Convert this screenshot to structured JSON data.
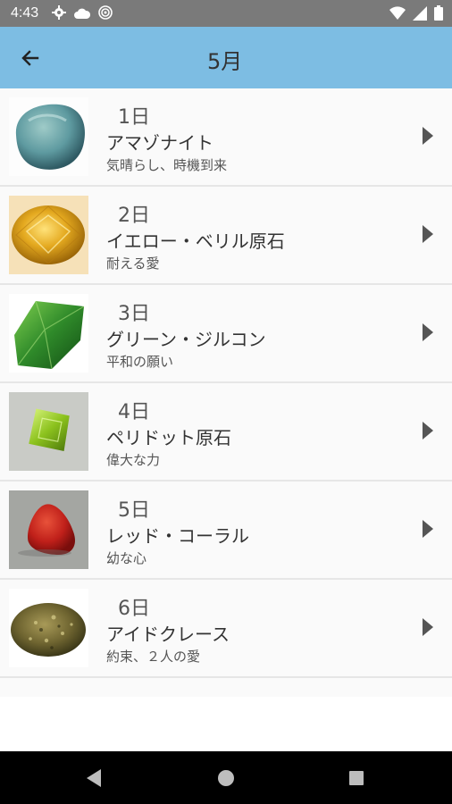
{
  "status_bar": {
    "time": "4:43",
    "icons_left": [
      "gear-icon",
      "cloud-icon",
      "target-icon"
    ],
    "icons_right": [
      "wifi-icon",
      "signal-icon",
      "battery-icon"
    ]
  },
  "app_bar": {
    "back_icon": "arrow-left-icon",
    "title": "5月"
  },
  "colors": {
    "app_bar": "#7dbde3",
    "status_bar": "#7a7a7a",
    "nav_bar": "#000000"
  },
  "stones": [
    {
      "day": "1日",
      "name": "アマゾナイト",
      "meaning": "気晴らし、時機到来",
      "image": "amazonite-image"
    },
    {
      "day": "2日",
      "name": "イエロー・ベリル原石",
      "meaning": "耐える愛",
      "image": "yellow-beryl-image"
    },
    {
      "day": "3日",
      "name": "グリーン・ジルコン",
      "meaning": "平和の願い",
      "image": "green-zircon-image"
    },
    {
      "day": "4日",
      "name": "ペリドット原石",
      "meaning": "偉大な力",
      "image": "peridot-image"
    },
    {
      "day": "5日",
      "name": "レッド・コーラル",
      "meaning": "幼な心",
      "image": "red-coral-image"
    },
    {
      "day": "6日",
      "name": "アイドクレース",
      "meaning": "約束、２人の愛",
      "image": "idocrase-image"
    },
    {
      "day": "7日",
      "name": "",
      "meaning": "",
      "image": ""
    }
  ],
  "nav_bar": {
    "back": "nav-back-icon",
    "home": "nav-home-icon",
    "recent": "nav-recents-icon"
  }
}
